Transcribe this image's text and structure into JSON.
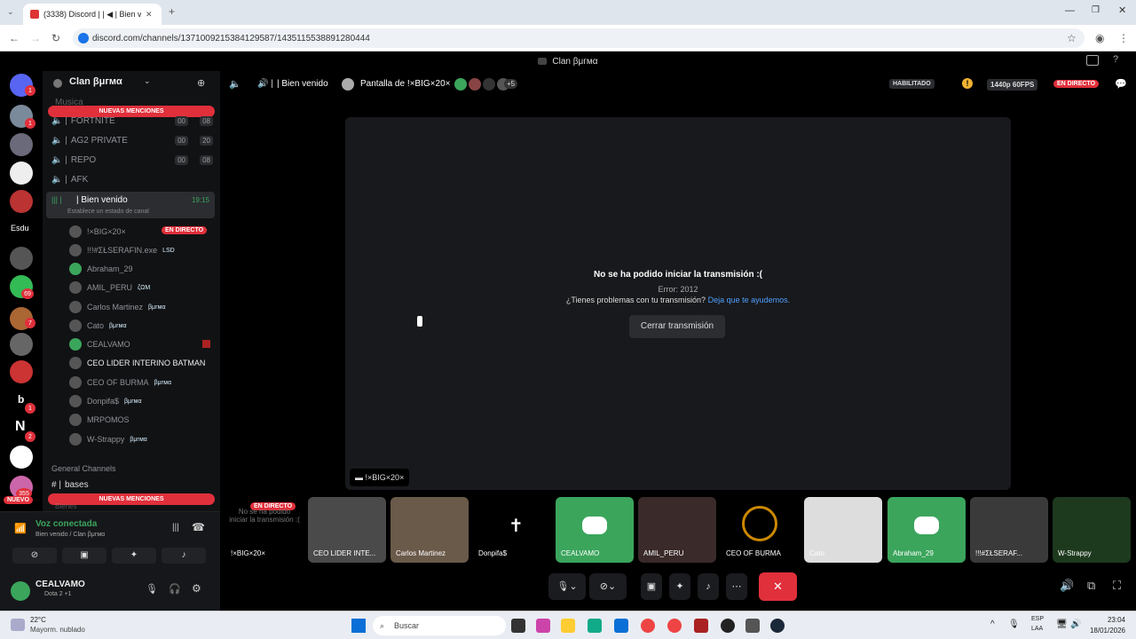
{
  "browser": {
    "tab_title": "(3338) Discord | | ◀ | Bien ve",
    "url": "discord.com/channels/1371009215384129587/1435115538891280444"
  },
  "discord": {
    "window_title": "Clan βμгмα",
    "server_name": "Clan βμгмα",
    "new_mentions": "NUEVAS MENCIONES",
    "guild_badges": [
      "1",
      "1",
      "69",
      "7",
      "1",
      "2",
      "355"
    ],
    "guild_labels": [
      "Esdu",
      "b",
      "N",
      "NUEVO"
    ],
    "channels": [
      {
        "name": "Musica",
        "count_a": "",
        "count_b": ""
      },
      {
        "name": "FORTNITE",
        "count_a": "00",
        "count_b": "08"
      },
      {
        "name": "AG2 PRIVATE",
        "count_a": "00",
        "count_b": "20"
      },
      {
        "name": "REPO",
        "count_a": "00",
        "count_b": "08"
      },
      {
        "name": "AFK",
        "count_a": "",
        "count_b": ""
      }
    ],
    "active_channel": {
      "name": "| Bien venido",
      "time": "19:15",
      "status_hint": "Establece un estado de canal"
    },
    "members": [
      {
        "name": "!×BIG×20×",
        "tag": "EN DIRECTO"
      },
      {
        "name": "!!!#ΣŁSERAFIN.exe",
        "tag": "LSD"
      },
      {
        "name": "Abraham_29",
        "tag": ""
      },
      {
        "name": "AMIL_PERU",
        "tag": "ζΩΜ"
      },
      {
        "name": "Carlos Martinez",
        "tag": "βμгмα"
      },
      {
        "name": "Cato",
        "tag": "βμгмα"
      },
      {
        "name": "CEALVAMO",
        "tag": ""
      },
      {
        "name": "CEO LIDER INTERINO BATMAN",
        "tag": ""
      },
      {
        "name": "CEO OF BURMA",
        "tag": "βμгмα"
      },
      {
        "name": "Donpifa$",
        "tag": "βμгмα"
      },
      {
        "name": "MRPOMOS",
        "tag": ""
      },
      {
        "name": "W-Strappy",
        "tag": "βμгмα"
      }
    ],
    "category": "General Channels",
    "bases_channel": "bases",
    "bottom_channel": "Bienes",
    "voice": {
      "status": "Voz conectada",
      "location": "Bien venido / Clan βμгмα"
    },
    "user": {
      "name": "CEALVAMO",
      "status": "Dota 2 +1"
    },
    "stage": {
      "channel": "| Bien venido",
      "screen": "Pantalla de !×BIG×20×",
      "extra_count": "+5",
      "habilitado": "HABILITADO",
      "quality": "1440p 60FPS",
      "live": "EN DIRECTO",
      "error_title": "No se ha podido iniciar la transmisión :(",
      "error_code": "Error: 2012",
      "help_text": "¿Tienes problemas con tu transmisión?",
      "help_link": "Deja que te ayudemos.",
      "close_button": "Cerrar transmisión",
      "stream_label": "!×BIG×20×"
    },
    "tiles": [
      {
        "name": "!×BIG×20×",
        "overlay": "No se ha podido iniciar la transmisión :(",
        "badge": "EN DIRECTO"
      },
      {
        "name": "CEO LIDER INTE..."
      },
      {
        "name": "Carlos Martinez"
      },
      {
        "name": "Donpifa$"
      },
      {
        "name": "CEALVAMO"
      },
      {
        "name": "AMIL_PERU"
      },
      {
        "name": "CEO OF BURMA"
      },
      {
        "name": "Cato"
      },
      {
        "name": "Abraham_29"
      },
      {
        "name": "!!!#ΣŁSERAF..."
      },
      {
        "name": "W-Strappy"
      }
    ]
  },
  "taskbar": {
    "temp": "22°C",
    "weather": "Mayorm. nublado",
    "search": "Buscar",
    "lang": "ESP",
    "lang2": "LAA",
    "time": "23:04",
    "date": "18/01/2026"
  }
}
